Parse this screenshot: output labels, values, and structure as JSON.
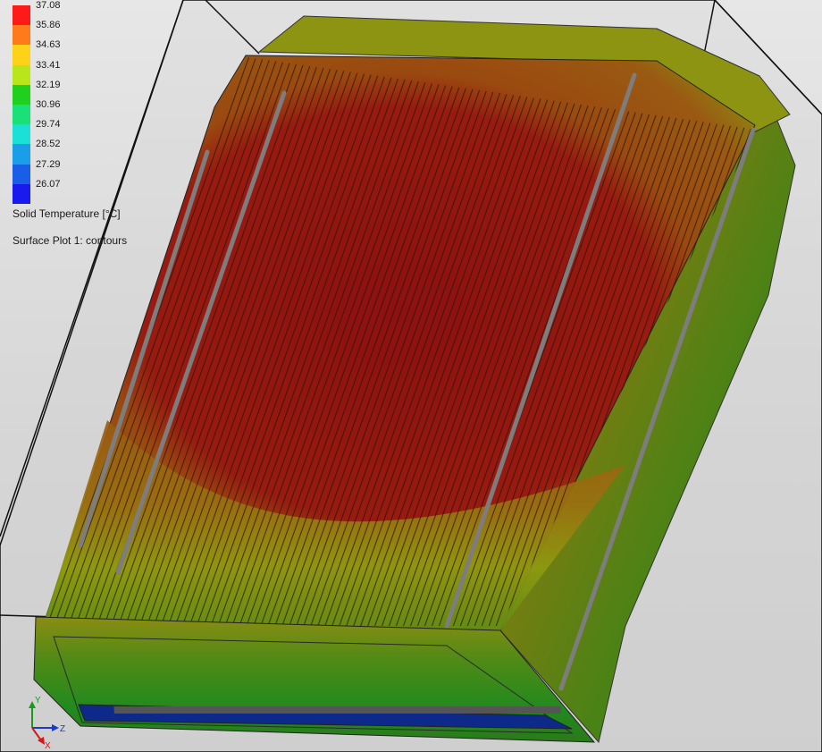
{
  "legend": {
    "ticks": [
      "37.08",
      "35.86",
      "34.63",
      "33.41",
      "32.19",
      "30.96",
      "29.74",
      "28.52",
      "27.29",
      "26.07"
    ],
    "colors": [
      "#ff1a1a",
      "#ff7a1a",
      "#ffd21a",
      "#b8e61a",
      "#1fd01f",
      "#1ae07a",
      "#1ae0d8",
      "#1a9ee8",
      "#1a5ee8",
      "#1a1aee"
    ],
    "quantity": "Solid Temperature [°C]",
    "plot_name": "Surface Plot 1: contours"
  },
  "triad": {
    "y": "Y",
    "z": "Z",
    "x": "X"
  },
  "model": {
    "colors": {
      "hot": "#8f1212",
      "warm": "#9a4a10",
      "mild": "#8a8e10",
      "cool": "#2f8a1a",
      "cold": "#0d2a8a",
      "frame": "#8a8a8a"
    }
  }
}
